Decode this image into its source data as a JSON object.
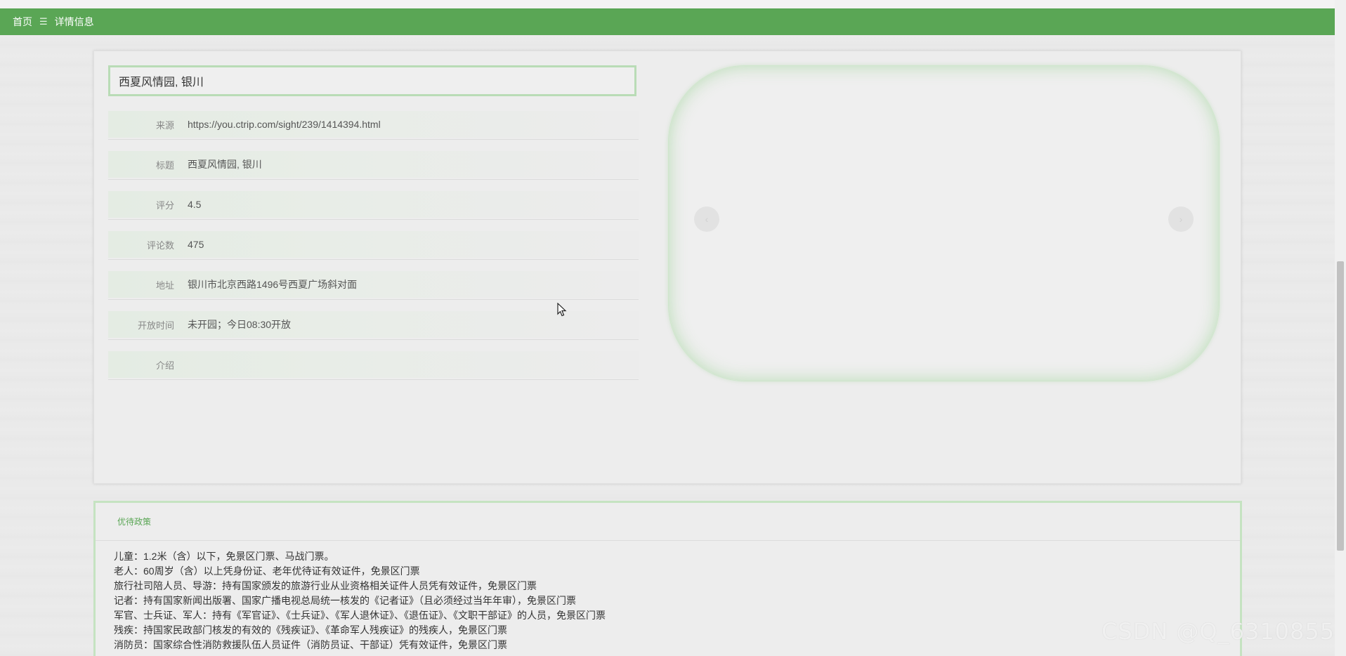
{
  "breadcrumb": {
    "home": "首页",
    "separator": "☰",
    "current": "详情信息"
  },
  "detail": {
    "title": "西夏风情园, 银川",
    "rows": [
      {
        "label": "来源",
        "value": "https://you.ctrip.com/sight/239/1414394.html"
      },
      {
        "label": "标题",
        "value": "西夏风情园, 银川"
      },
      {
        "label": "评分",
        "value": "4.5"
      },
      {
        "label": "评论数",
        "value": "475"
      },
      {
        "label": "地址",
        "value": "银川市北京西路1496号西夏广场斜对面"
      },
      {
        "label": "开放时间",
        "value": "未开园；今日08:30开放"
      },
      {
        "label": "介绍",
        "value": ""
      }
    ]
  },
  "carousel": {
    "prev_icon": "chevron-left-icon",
    "next_icon": "chevron-right-icon",
    "prev_glyph": "‹",
    "next_glyph": "›"
  },
  "policy": {
    "header": "优待政策",
    "items": [
      "儿童：1.2米（含）以下，免景区门票、马战门票。",
      "老人：60周岁（含）以上凭身份证、老年优待证有效证件，免景区门票",
      "旅行社司陪人员、导游：持有国家颁发的旅游行业从业资格相关证件人员凭有效证件，免景区门票",
      "记者：持有国家新闻出版署、国家广播电视总局统一核发的《记者证》（且必须经过当年年审），免景区门票",
      "军官、士兵证、军人：持有《军官证》、《士兵证》、《军人退休证》、《退伍证》、《文职干部证》的人员，免景区门票",
      "残疾：持国家民政部门核发的有效的《残疾证》、《革命军人残疾证》的残疾人，免景区门票",
      "消防员：国家综合性消防救援队伍人员证件（消防员证、干部证）凭有效证件，免景区门票"
    ]
  },
  "watermark": "CSDN @Q_6310855",
  "colors": {
    "navbar": "#5aa655",
    "accent_border": "#b9dcb6",
    "policy_header": "#5aa655"
  }
}
